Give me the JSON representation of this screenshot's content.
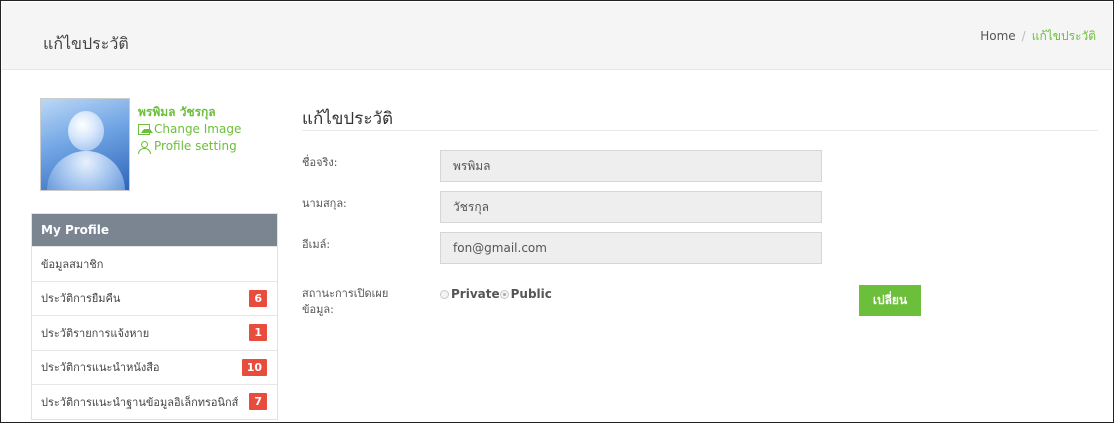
{
  "header": {
    "title": "แก้ไขประวัติ"
  },
  "breadcrumb": {
    "home": "Home",
    "separator": "/",
    "current": "แก้ไขประวัติ"
  },
  "profile": {
    "name": "พรพิมล วัชรกุล",
    "change_image": "Change Image",
    "profile_setting": "Profile setting"
  },
  "menu": {
    "header": "My Profile",
    "items": [
      {
        "label": "ข้อมูลสมาชิก",
        "badge": ""
      },
      {
        "label": "ประวัติการยืมคืน",
        "badge": "6"
      },
      {
        "label": "ประวัติรายการแจ้งหาย",
        "badge": "1"
      },
      {
        "label": "ประวัติการแนะนำหนังสือ",
        "badge": "10"
      },
      {
        "label": "ประวัติการแนะนำฐานข้อมูลอิเล็กทรอนิกส์",
        "badge": "7"
      }
    ]
  },
  "form": {
    "title": "แก้ไขประวัติ",
    "first_name_label": "ชื่อจริง:",
    "first_name_value": "พรพิมล",
    "last_name_label": "นามสกุล:",
    "last_name_value": "วัชรกุล",
    "email_label": "อีเมล์:",
    "email_value": "fon@gmail.com",
    "visibility_label_line1": "สถานะการเปิดเผย",
    "visibility_label_line2": "ข้อมูล:",
    "private_label": "Private",
    "public_label": "Public",
    "selected_visibility": "Public",
    "submit_label": "เปลี่ยน"
  },
  "colors": {
    "accent": "#6cbf3a",
    "badge": "#e84c3d",
    "menu_header": "#7b8592"
  },
  "icons": {
    "change_image": "image-icon",
    "profile_setting": "user-icon"
  }
}
